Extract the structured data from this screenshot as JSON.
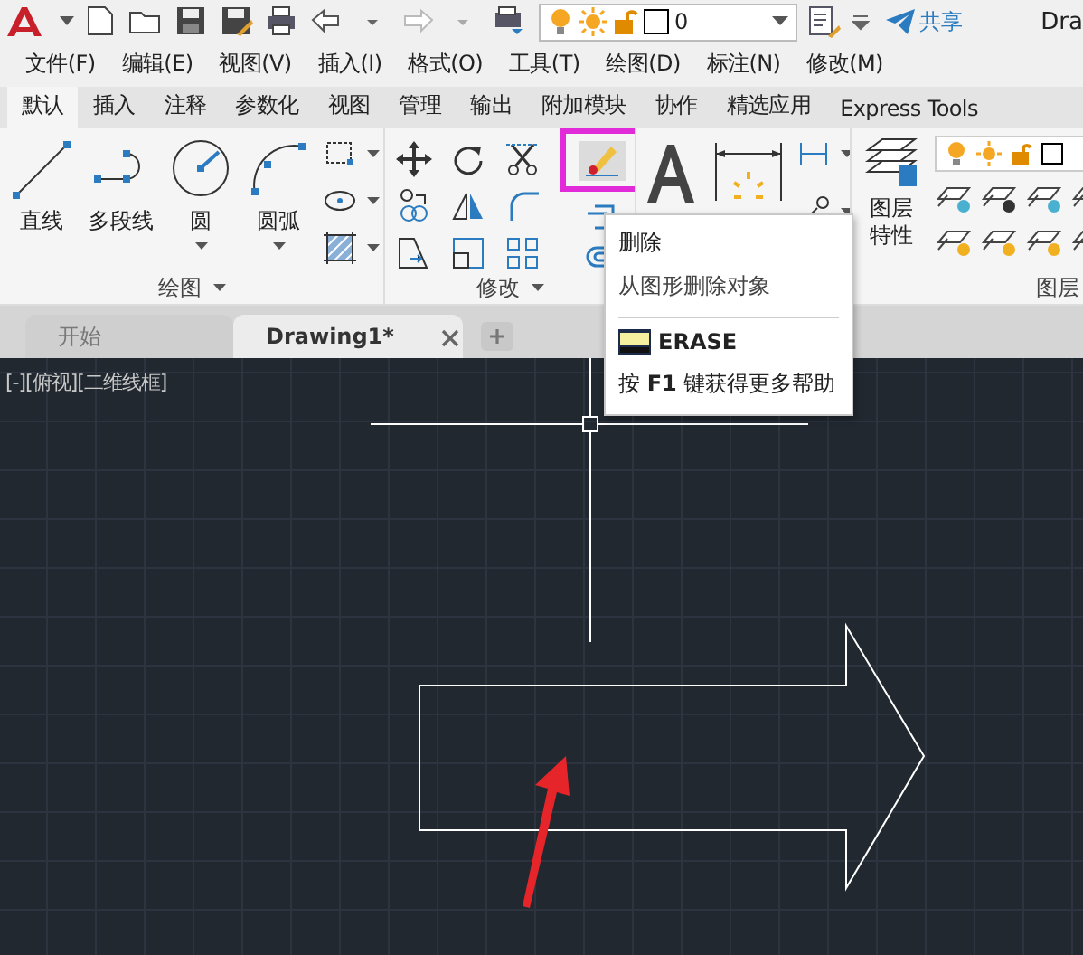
{
  "title_bar": {
    "layer": "0",
    "share": "共享",
    "title": "Dra"
  },
  "menu_bar": [
    {
      "label": "文件(F)"
    },
    {
      "label": "编辑(E)"
    },
    {
      "label": "视图(V)"
    },
    {
      "label": "插入(I)"
    },
    {
      "label": "格式(O)"
    },
    {
      "label": "工具(T)"
    },
    {
      "label": "绘图(D)"
    },
    {
      "label": "标注(N)"
    },
    {
      "label": "修改(M)"
    }
  ],
  "ribbon_tabs": [
    {
      "label": "默认",
      "selected": true
    },
    {
      "label": "插入",
      "selected": false
    },
    {
      "label": "注释",
      "selected": false
    },
    {
      "label": "参数化",
      "selected": false
    },
    {
      "label": "视图",
      "selected": false
    },
    {
      "label": "管理",
      "selected": false
    },
    {
      "label": "输出",
      "selected": false
    },
    {
      "label": "附加模块",
      "selected": false
    },
    {
      "label": "协作",
      "selected": false
    },
    {
      "label": "精选应用",
      "selected": false
    },
    {
      "label": "Express Tools",
      "selected": false
    }
  ],
  "draw_panel": {
    "title": "绘图",
    "tools": [
      {
        "kind": "line",
        "label": "直线"
      },
      {
        "kind": "polyline",
        "label": "多段线"
      },
      {
        "kind": "circle",
        "label": "圆"
      },
      {
        "kind": "arc",
        "label": "圆弧"
      }
    ]
  },
  "modify_panel": {
    "title": "修改",
    "erase_highlighted": true
  },
  "layers_panel": {
    "title": "图层",
    "properties_label": "图层特性"
  },
  "document_tabs": [
    {
      "label": "开始",
      "selected": false
    },
    {
      "label": "Drawing1*",
      "selected": true
    }
  ],
  "viewport_label": "[-][俯视][二维线框]",
  "tooltip": {
    "title": "删除",
    "description": "从图形删除对象",
    "command": "ERASE",
    "help": "按 **F1** 键获得更多帮助"
  }
}
